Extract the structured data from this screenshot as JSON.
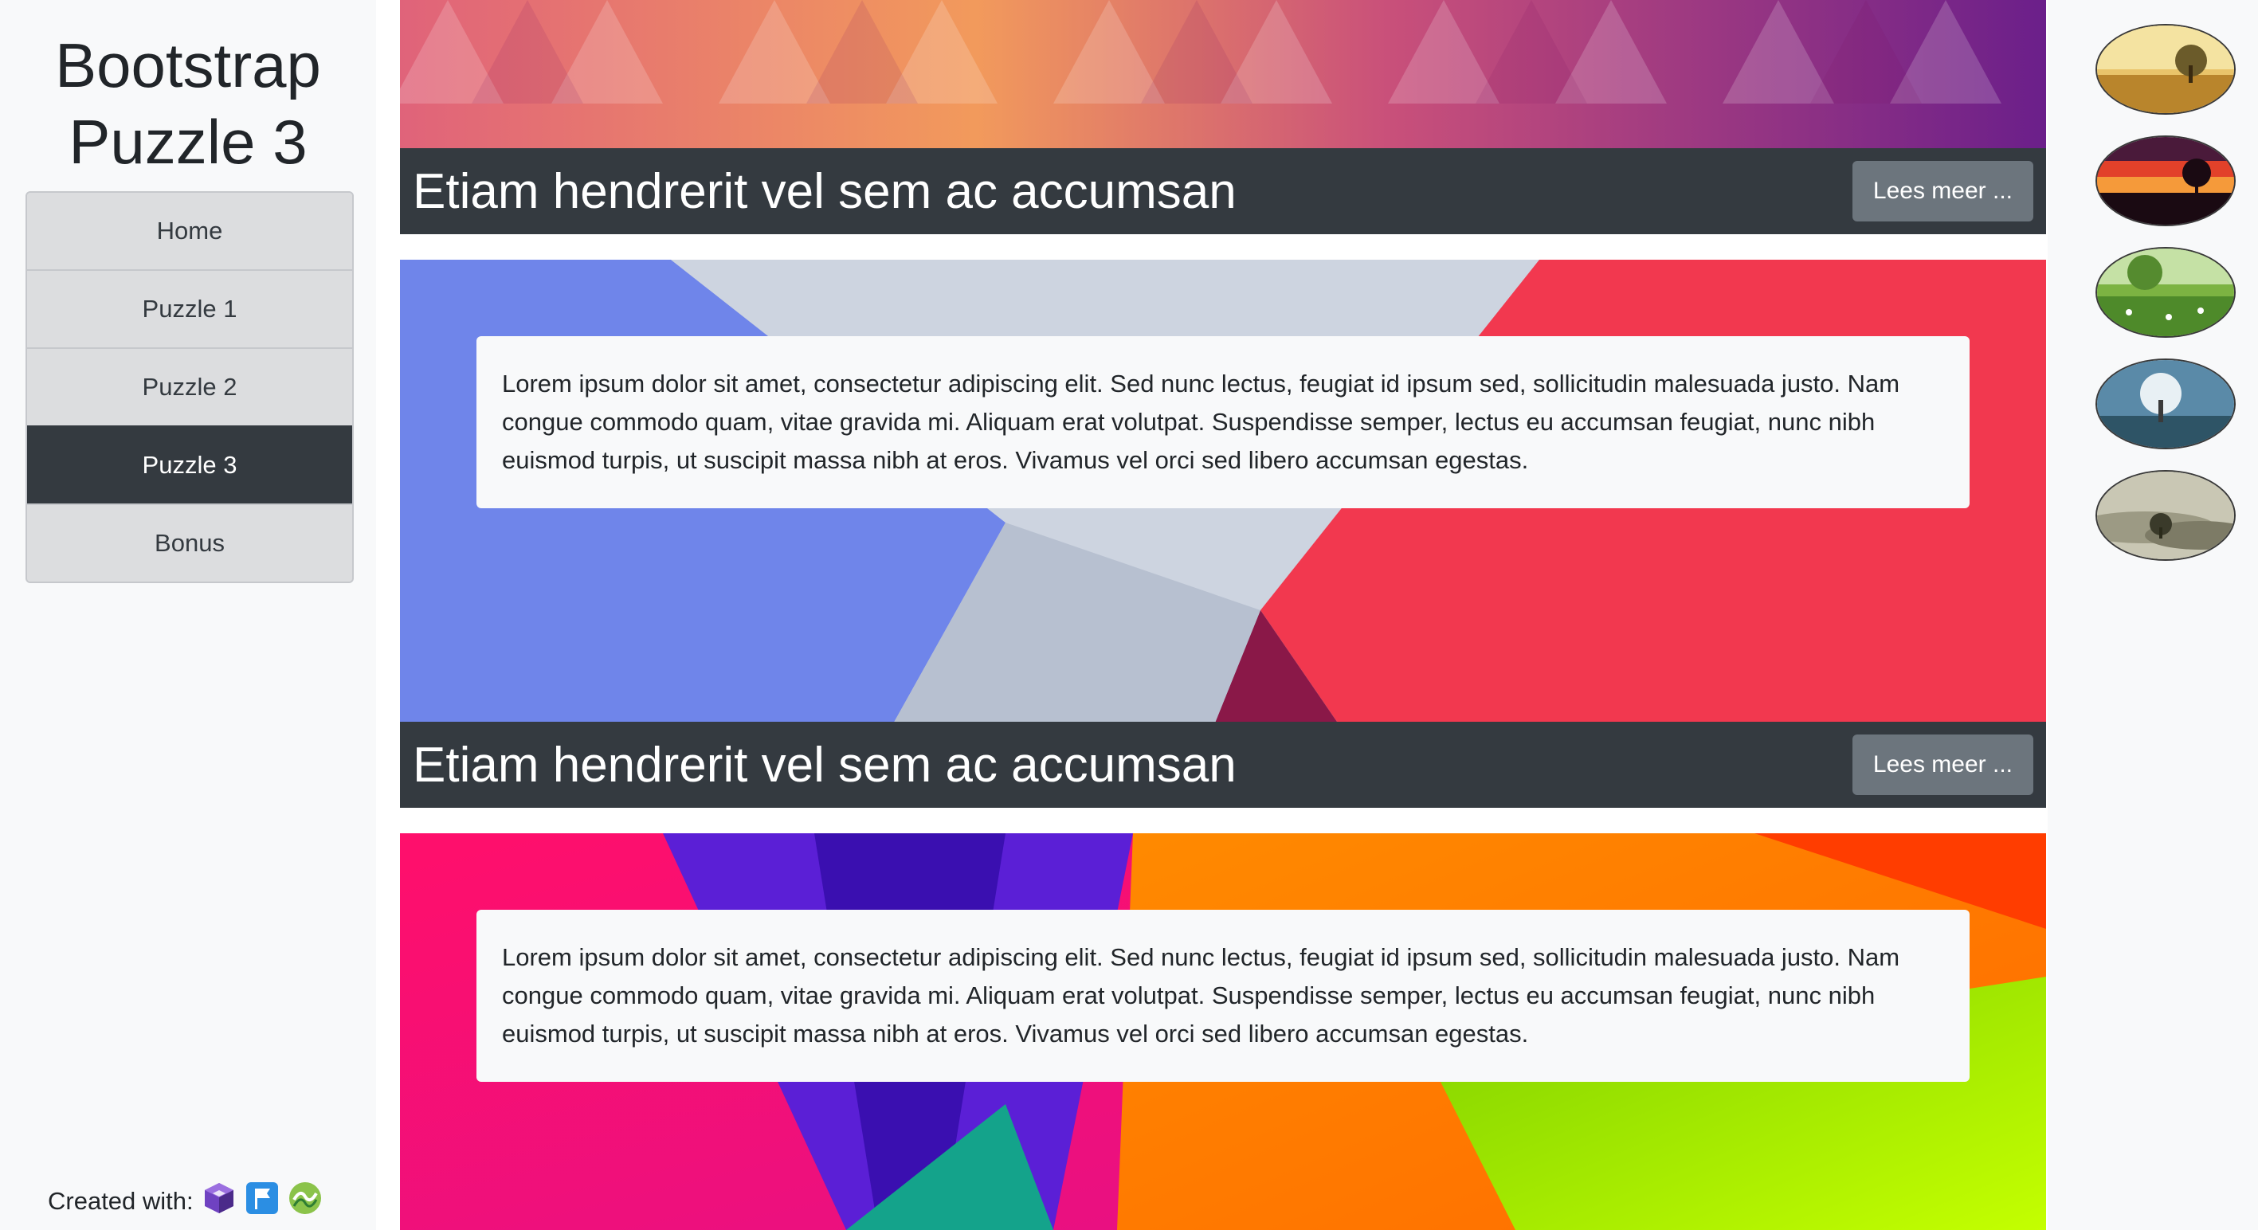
{
  "sidebar": {
    "title_line1": "Bootstrap",
    "title_line2": "Puzzle 3",
    "nav": [
      {
        "label": "Home"
      },
      {
        "label": "Puzzle 1"
      },
      {
        "label": "Puzzle 2"
      },
      {
        "label": "Puzzle 3",
        "active": true
      },
      {
        "label": "Bonus"
      }
    ],
    "credits_label": "Created with:",
    "credit_icons": [
      "cube-icon",
      "flag-icon",
      "vuejs-like-icon"
    ]
  },
  "cards": [
    {
      "title": "Etiam hendrerit vel sem ac accumsan",
      "button": "Lees meer ..."
    },
    {
      "text": "Lorem ipsum dolor sit amet, consectetur adipiscing elit. Sed nunc lectus, feugiat id ipsum sed, sollicitudin malesuada justo. Nam congue commodo quam, vitae gravida mi. Aliquam erat volutpat. Suspendisse semper, lectus eu accumsan feugiat, nunc nibh euismod turpis, ut suscipit massa nibh at eros. Vivamus vel orci sed libero accumsan egestas.",
      "title": "Etiam hendrerit vel sem ac accumsan",
      "button": "Lees meer ..."
    },
    {
      "text": "Lorem ipsum dolor sit amet, consectetur adipiscing elit. Sed nunc lectus, feugiat id ipsum sed, sollicitudin malesuada justo. Nam congue commodo quam, vitae gravida mi. Aliquam erat volutpat. Suspendisse semper, lectus eu accumsan feugiat, nunc nibh euismod turpis, ut suscipit massa nibh at eros. Vivamus vel orci sed libero accumsan egestas."
    }
  ],
  "thumbnails": [
    "golden-field-tree",
    "red-sunset-tree",
    "green-meadow",
    "frosted-tree",
    "foggy-hills-tree"
  ],
  "colors": {
    "dark": "#343a40",
    "secondary": "#6c757d",
    "light": "#f8f9fa",
    "nav_bg": "#dcdddf"
  }
}
